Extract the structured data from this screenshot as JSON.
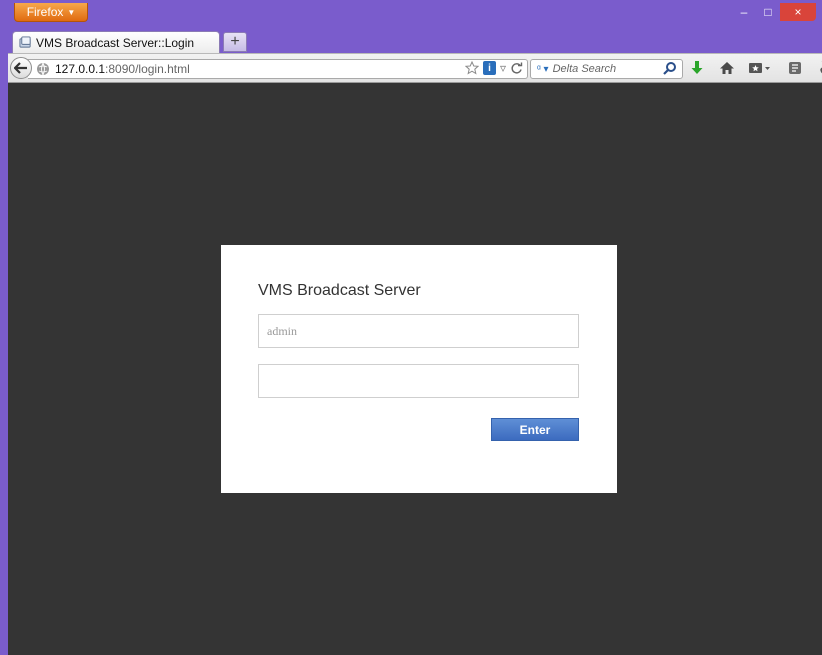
{
  "browser": {
    "app_button_label": "Firefox",
    "tab": {
      "title": "VMS Broadcast Server::Login"
    },
    "new_tab_label": "+",
    "url": {
      "host": "127.0.0.1",
      "rest": ":8090/login.html"
    },
    "search": {
      "engine_icon": "delta-search-icon",
      "placeholder": "Delta Search"
    },
    "window_controls": {
      "minimize": "–",
      "maximize": "□",
      "close": "×"
    },
    "colors": {
      "titlebar": "#7a5ccc",
      "app_button": "#e06b10",
      "close_button": "#d9443a",
      "download_arrow": "#2aa52a"
    }
  },
  "page": {
    "background": "#343434",
    "login": {
      "title": "VMS Broadcast Server",
      "username_placeholder": "admin",
      "password_value": "",
      "enter_label": "Enter"
    },
    "colors": {
      "enter_button": "#4a7ac9"
    }
  }
}
